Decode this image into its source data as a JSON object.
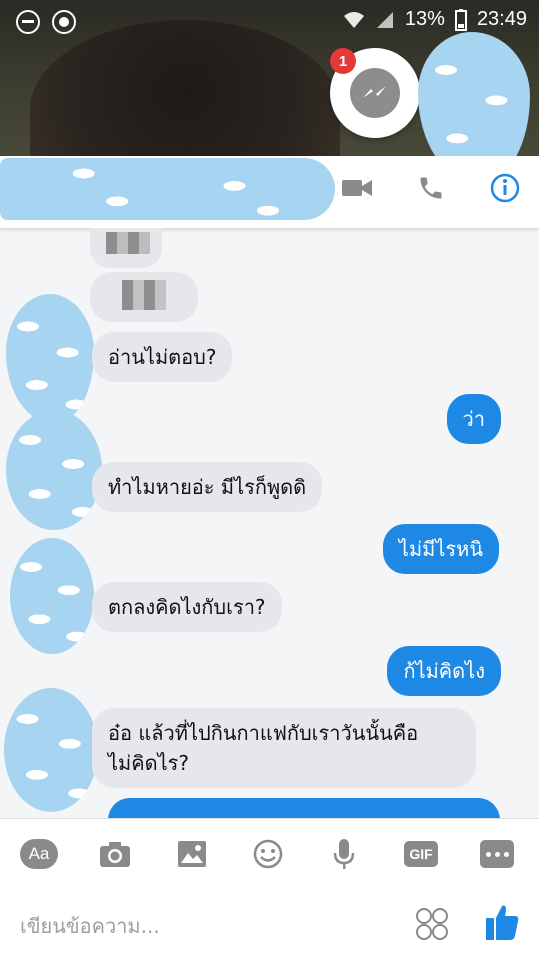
{
  "status_bar": {
    "battery": "13%",
    "time": "23:49"
  },
  "chat_head": {
    "badge_count": "1"
  },
  "messages": [
    {
      "side": "in",
      "text": "อ่านไม่ตอบ?"
    },
    {
      "side": "out",
      "text": "ว่า"
    },
    {
      "side": "in",
      "text": "ทำไมหายอ่ะ มีไรก็พูดดิ"
    },
    {
      "side": "out",
      "text": "ไม่มีไรหนิ"
    },
    {
      "side": "in",
      "text": "ตกลงคิดไงกับเรา?"
    },
    {
      "side": "out",
      "text": "ก้ไม่คิดไง"
    },
    {
      "side": "in",
      "text_line1": "อ๋อ แล้วที่ไปกินกาแฟกับเราวันนั้นคือ",
      "text_line2": "ไม่คิดไร?"
    }
  ],
  "toolbar": {
    "aa_label": "Aa",
    "gif_label": "GIF"
  },
  "composer": {
    "placeholder": "เขียนข้อความ..."
  },
  "colors": {
    "accent": "#1e88e5",
    "incoming": "#e6e7eb",
    "badge": "#e53935",
    "sticker_blob": "#a7d4f0"
  }
}
